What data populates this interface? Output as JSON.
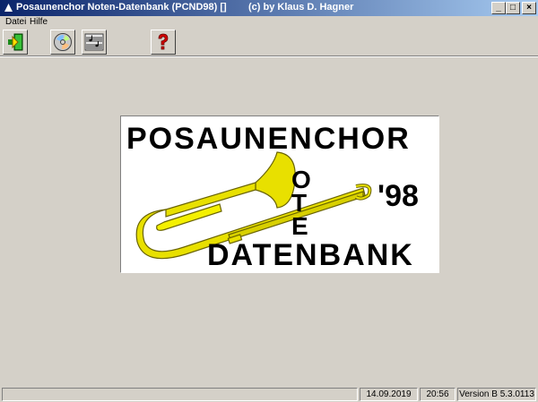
{
  "window": {
    "title": "Posaunenchor Noten-Datenbank (PCND98) []",
    "credit": "(c) by Klaus D. Hagner",
    "minimize_glyph": "_",
    "maximize_glyph": "□",
    "close_glyph": "×"
  },
  "menu": {
    "items": [
      "Datei",
      "Hilfe"
    ]
  },
  "toolbar": {
    "buttons": [
      {
        "icon": "exit-door-icon"
      },
      {
        "icon": "cd-icon"
      },
      {
        "icon": "sheet-music-icon"
      },
      {
        "icon": "help-question-icon"
      }
    ]
  },
  "splash": {
    "line1": "POSAUNENCHOR",
    "vertical_letters": [
      "O",
      "T",
      "E"
    ],
    "year": "'98",
    "line3": "DATENBANK",
    "colors": {
      "text": "#000000",
      "trombone": "#e8e000",
      "trombone_shade": "#8a8400"
    }
  },
  "status": {
    "date": "14.09.2019",
    "time": "20:56",
    "version": "Version B 5.3.0113"
  }
}
